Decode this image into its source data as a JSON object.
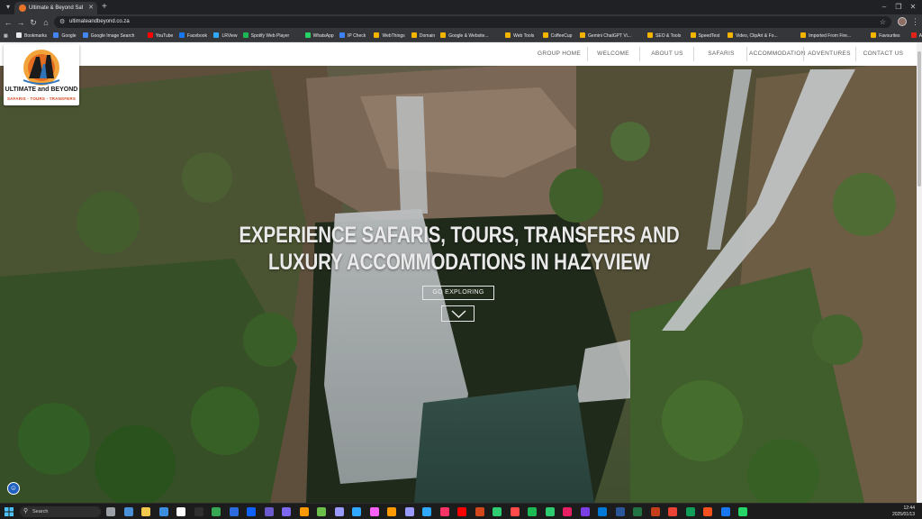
{
  "browser": {
    "tab_title": "Ultimate & Beyond Safari Pro",
    "url": "ultimateandbeyond.co.za",
    "bookmarks": [
      {
        "label": "Bookmarks",
        "color": "#e8eaed"
      },
      {
        "label": "Google",
        "color": "#4285f4"
      },
      {
        "label": "Google Image Search",
        "color": "#4285f4"
      },
      {
        "label": "YouTube",
        "color": "#ff0000"
      },
      {
        "label": "Facebook",
        "color": "#1877f2"
      },
      {
        "label": "LRView",
        "color": "#31a8ff"
      },
      {
        "label": "Spotify Web Player",
        "color": "#1db954"
      },
      {
        "label": "WhatsApp",
        "color": "#25d366"
      },
      {
        "label": "IP Check",
        "color": "#3b82f6"
      },
      {
        "label": "WebThings",
        "color": "#f4b400"
      },
      {
        "label": "Domain",
        "color": "#f4b400"
      },
      {
        "label": "Google & Website...",
        "color": "#f4b400"
      },
      {
        "label": "Web Tools",
        "color": "#f4b400"
      },
      {
        "label": "CoffeeCup",
        "color": "#f4b400"
      },
      {
        "label": "Gemini ChatGPT Vi...",
        "color": "#f4b400"
      },
      {
        "label": "SEO & Tools",
        "color": "#f4b400"
      },
      {
        "label": "SpeedTest",
        "color": "#f4b400"
      },
      {
        "label": "Video, ClipArt & Fo...",
        "color": "#f4b400"
      },
      {
        "label": "Imported From Fire...",
        "color": "#f4b400"
      },
      {
        "label": "Favourites",
        "color": "#f4b400"
      },
      {
        "label": "Adobe Acrobat",
        "color": "#e2231a"
      }
    ]
  },
  "site": {
    "logo": {
      "brand": "ULTIMATE and BEYOND",
      "tagline": "SAFARIS - TOURS - TRANSFERS"
    },
    "nav": [
      "GROUP HOME",
      "WELCOME",
      "ABOUT US",
      "SAFARIS",
      "ACCOMMODATION",
      "ADVENTURES",
      "CONTACT US"
    ],
    "hero": {
      "headline_line1": "EXPERIENCE SAFARIS, TOURS, TRANSFERS AND",
      "headline_line2": "LUXURY ACCOMMODATIONS IN HAZYVIEW",
      "cta_label": "GO EXPLORING"
    }
  },
  "taskbar": {
    "search_placeholder": "Search",
    "time": "12:44",
    "date": "2025/01/13",
    "app_colors": [
      "#9aa0a6",
      "#4a90d9",
      "#f2c94c",
      "#3c8dde",
      "#ffffff",
      "#2f2f2f",
      "#34a853",
      "#2d6cdf",
      "#0f62fe",
      "#6a5acd",
      "#7b68ee",
      "#ff9900",
      "#6cbf4a",
      "#9999ff",
      "#31a8ff",
      "#ff61f6",
      "#ff9a00",
      "#9999ff",
      "#2fa8ff",
      "#ff3366",
      "#ff0000",
      "#d4471c",
      "#2ecc71",
      "#ff4a4a",
      "#1db954",
      "#2ecc71",
      "#e91e63",
      "#7b3fe4",
      "#0078d4",
      "#2b579a",
      "#217346",
      "#c43e1c",
      "#ea4335",
      "#0f9d58",
      "#f4511e",
      "#1877f2",
      "#25d366"
    ]
  }
}
